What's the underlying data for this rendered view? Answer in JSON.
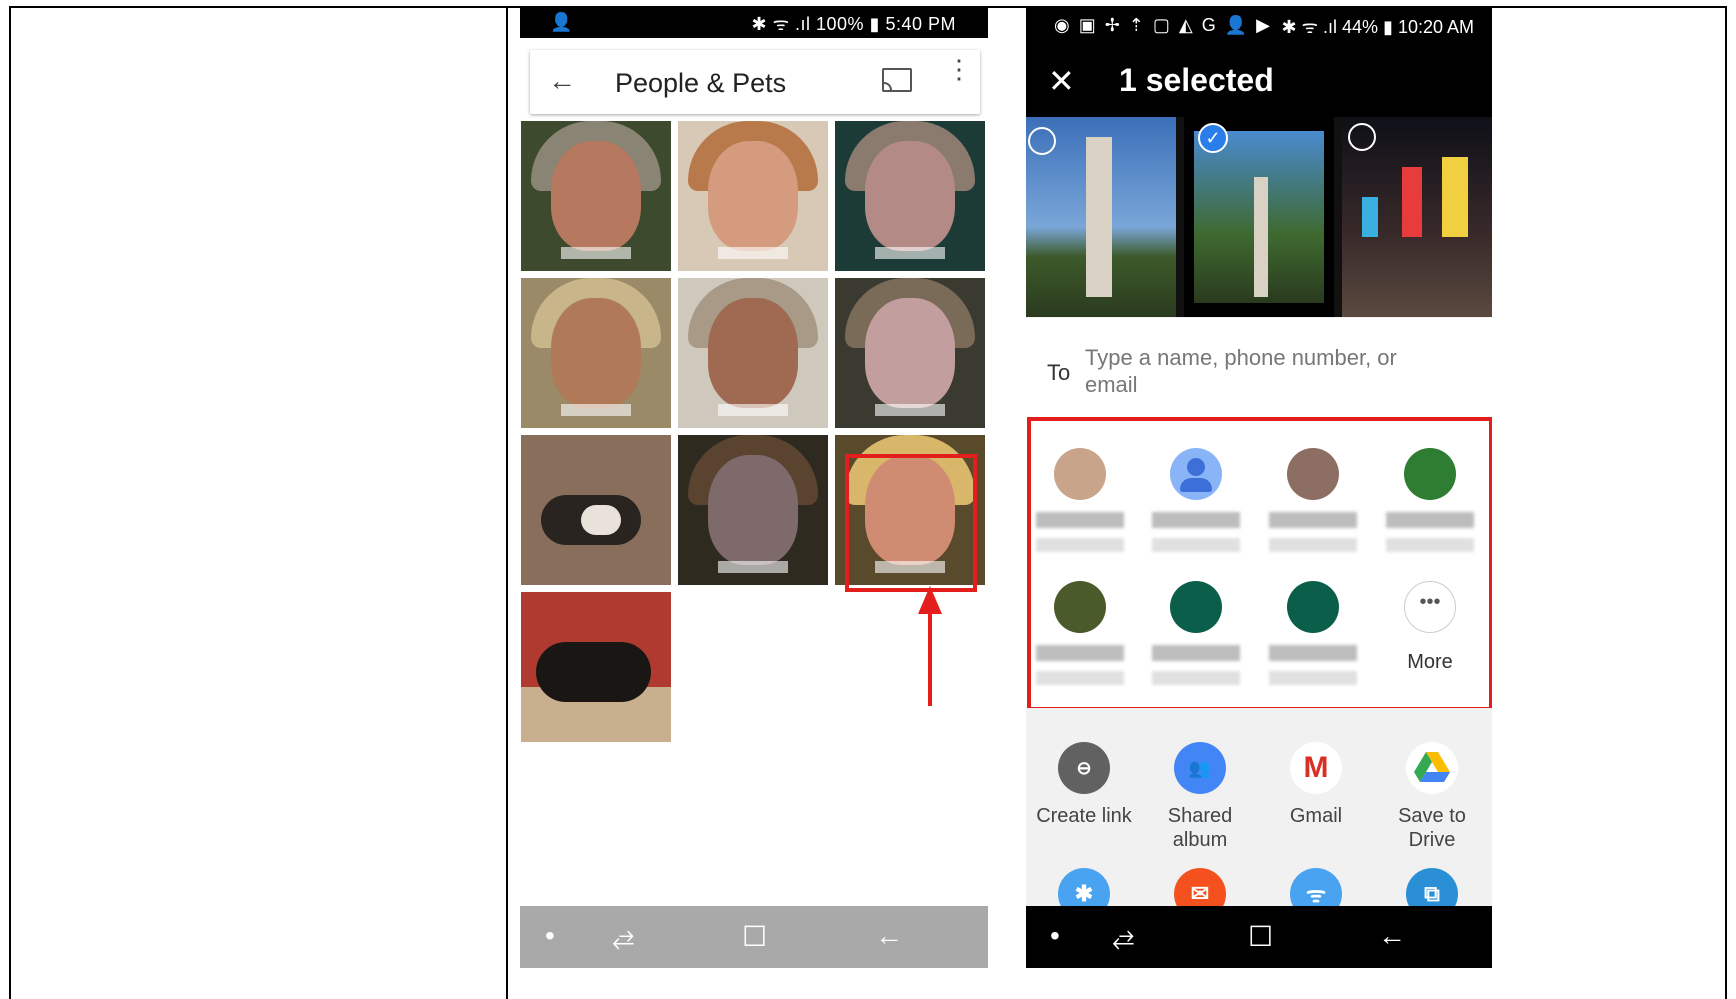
{
  "left_phone": {
    "status_bar": {
      "left": "👤",
      "right": "✱ ᯤ .ıl 100% ▮ 5:40 PM"
    },
    "app_bar": {
      "back": "←",
      "title": "People & Pets",
      "menu": "⋮"
    },
    "nav": {
      "dot": "•",
      "recents": "⥄",
      "home": "☐",
      "back": "←"
    }
  },
  "right_phone": {
    "status_bar": {
      "left": "◉ ▣ ✢ ⇡ ▢ ◭ G 👤 ▶",
      "right": "✱ ᯤ .ıl 44% ▮ 10:20 AM"
    },
    "header": {
      "close": "✕",
      "title": "1 selected"
    },
    "to_label": "To",
    "to_placeholder": "Type a name, phone number, or email",
    "more_label": "More",
    "more_glyph": "•••",
    "apps": [
      {
        "label": "Create link",
        "icon": "link-icon",
        "color": "#616161"
      },
      {
        "label": "Shared album",
        "icon": "people-icon",
        "color": "#4285f4"
      },
      {
        "label": "Gmail",
        "icon": "gmail-icon",
        "color": "#ffffff"
      },
      {
        "label": "Save to Drive",
        "icon": "drive-icon",
        "color": "#ffffff"
      }
    ],
    "bottom_icons": [
      {
        "icon": "bluetooth-icon",
        "color": "#4aa3f0"
      },
      {
        "icon": "email-icon",
        "color": "#f4511e"
      },
      {
        "icon": "wifi-direct-icon",
        "color": "#4aa3f0"
      },
      {
        "icon": "copy-icon",
        "color": "#2b8fd6"
      }
    ],
    "nav": {
      "dot": "•",
      "recents": "⥄",
      "home": "☐",
      "back": "←"
    }
  }
}
